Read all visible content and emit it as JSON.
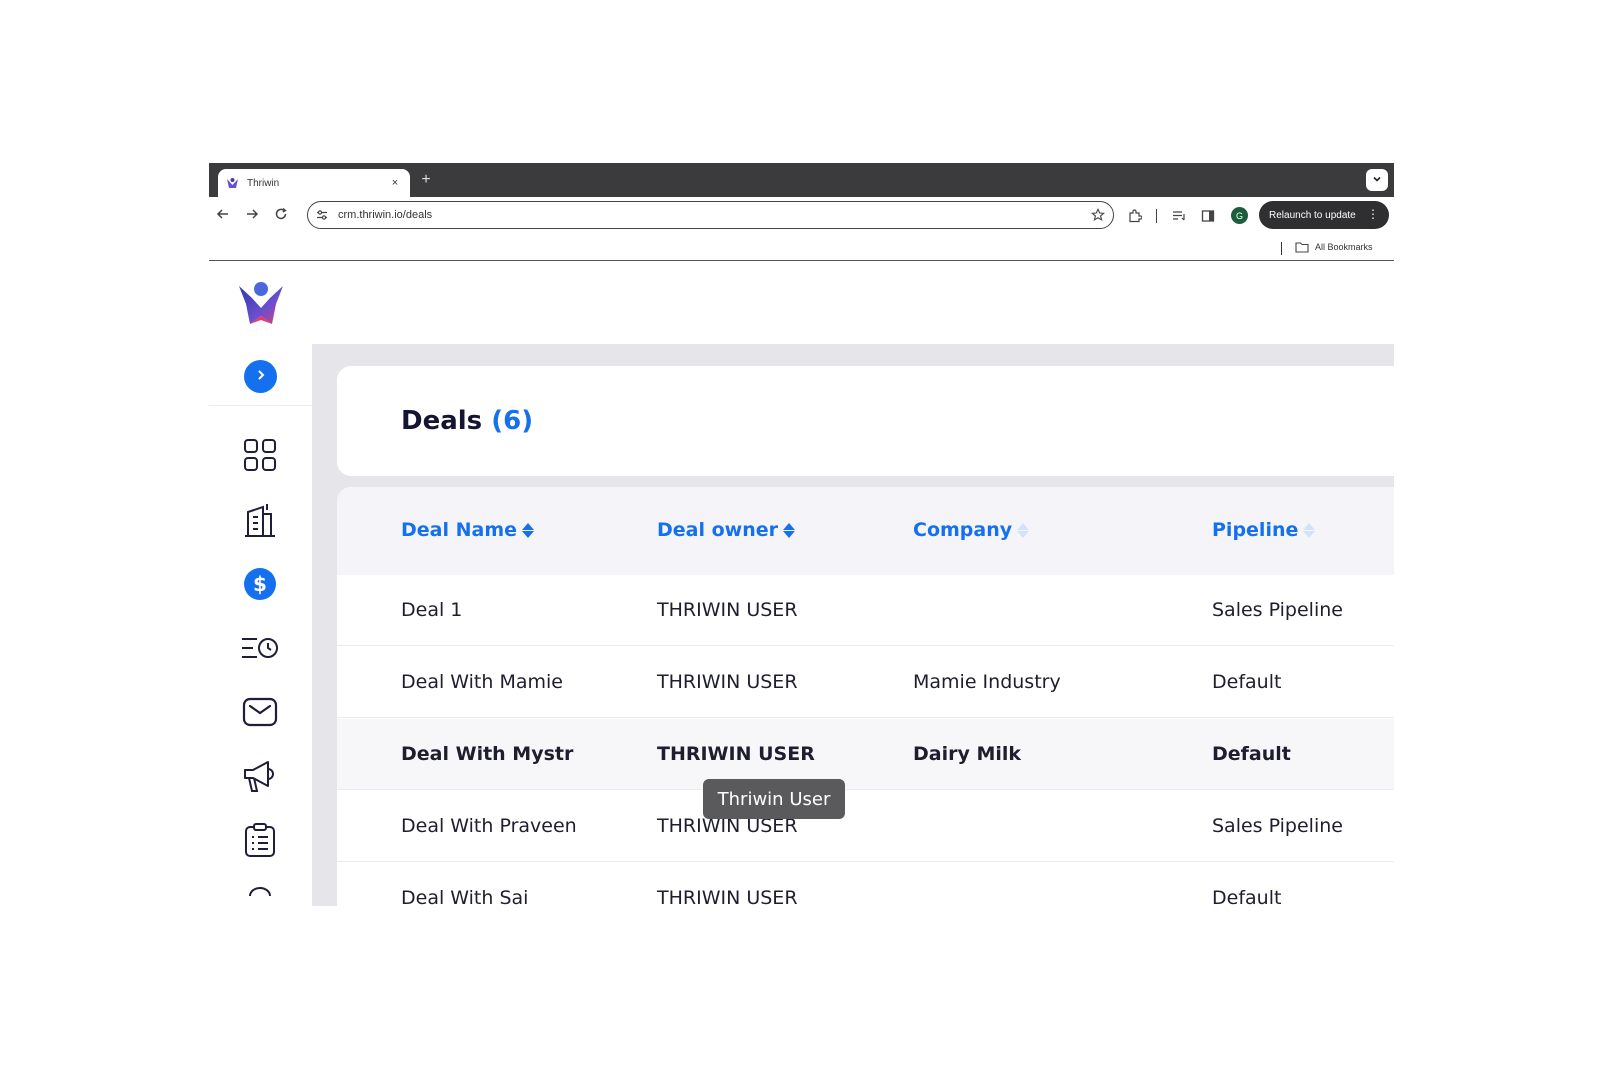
{
  "browser": {
    "tab_title": "Thriwin",
    "tab_close": "×",
    "new_tab": "+",
    "url": "crm.thriwin.io/deals",
    "profile_initial": "G",
    "relaunch_label": "Relaunch to update",
    "relaunch_menu": "⋮",
    "all_bookmarks": "All Bookmarks"
  },
  "sidebar": {
    "items": [
      {
        "name": "dashboard-icon"
      },
      {
        "name": "companies-icon"
      },
      {
        "name": "deals-icon"
      },
      {
        "name": "activities-icon"
      },
      {
        "name": "mail-icon"
      },
      {
        "name": "campaigns-icon"
      },
      {
        "name": "tasks-icon"
      }
    ]
  },
  "page": {
    "title": "Deals",
    "count": "(6)"
  },
  "table": {
    "columns": [
      "Deal Name",
      "Deal owner",
      "Company",
      "Pipeline"
    ],
    "rows": [
      [
        "Deal 1",
        "THRIWIN USER",
        "",
        "Sales Pipeline"
      ],
      [
        "Deal With Mamie",
        "THRIWIN USER",
        "Mamie Industry",
        "Default"
      ],
      [
        "Deal With Mystr",
        "THRIWIN USER",
        "Dairy Milk",
        "Default"
      ],
      [
        "Deal With Praveen",
        "THRIWIN USER",
        "",
        "Sales Pipeline"
      ],
      [
        "Deal With Sai",
        "THRIWIN USER",
        "",
        "Default"
      ]
    ]
  },
  "tooltip": {
    "text": "Thriwin User"
  },
  "colors": {
    "accent": "#1570ef",
    "title": "#141433",
    "chrome_dark": "#3b3b3d"
  }
}
